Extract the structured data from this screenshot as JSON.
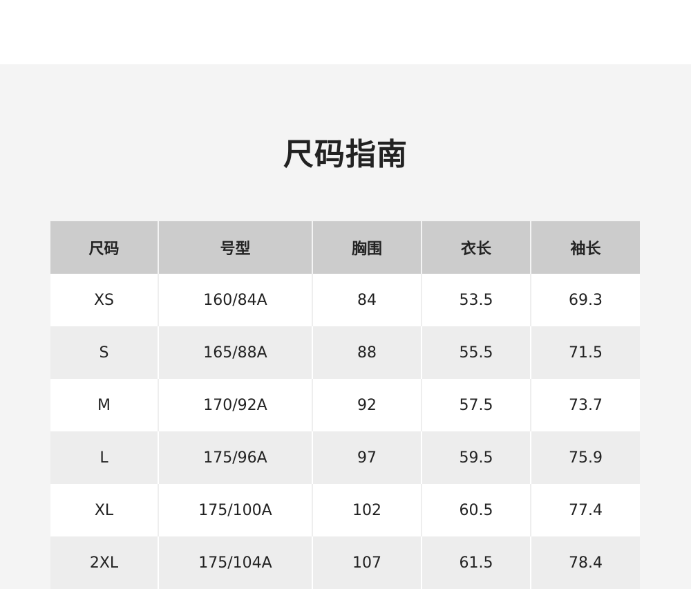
{
  "page": {
    "title": "尺码指南"
  },
  "table": {
    "headers": [
      "尺码",
      "号型",
      "胸围",
      "衣长",
      "袖长"
    ],
    "rows": [
      [
        "XS",
        "160/84A",
        "84",
        "53.5",
        "69.3"
      ],
      [
        "S",
        "165/88A",
        "88",
        "55.5",
        "71.5"
      ],
      [
        "M",
        "170/92A",
        "92",
        "57.5",
        "73.7"
      ],
      [
        "L",
        "175/96A",
        "97",
        "59.5",
        "75.9"
      ],
      [
        "XL",
        "175/100A",
        "102",
        "60.5",
        "77.4"
      ],
      [
        "2XL",
        "175/104A",
        "107",
        "61.5",
        "78.4"
      ]
    ]
  },
  "colors": {
    "panel_background": "#f4f4f4",
    "header_background": "#cccccc",
    "row_white": "#ffffff",
    "row_gray": "#ededed",
    "text": "#222222"
  }
}
